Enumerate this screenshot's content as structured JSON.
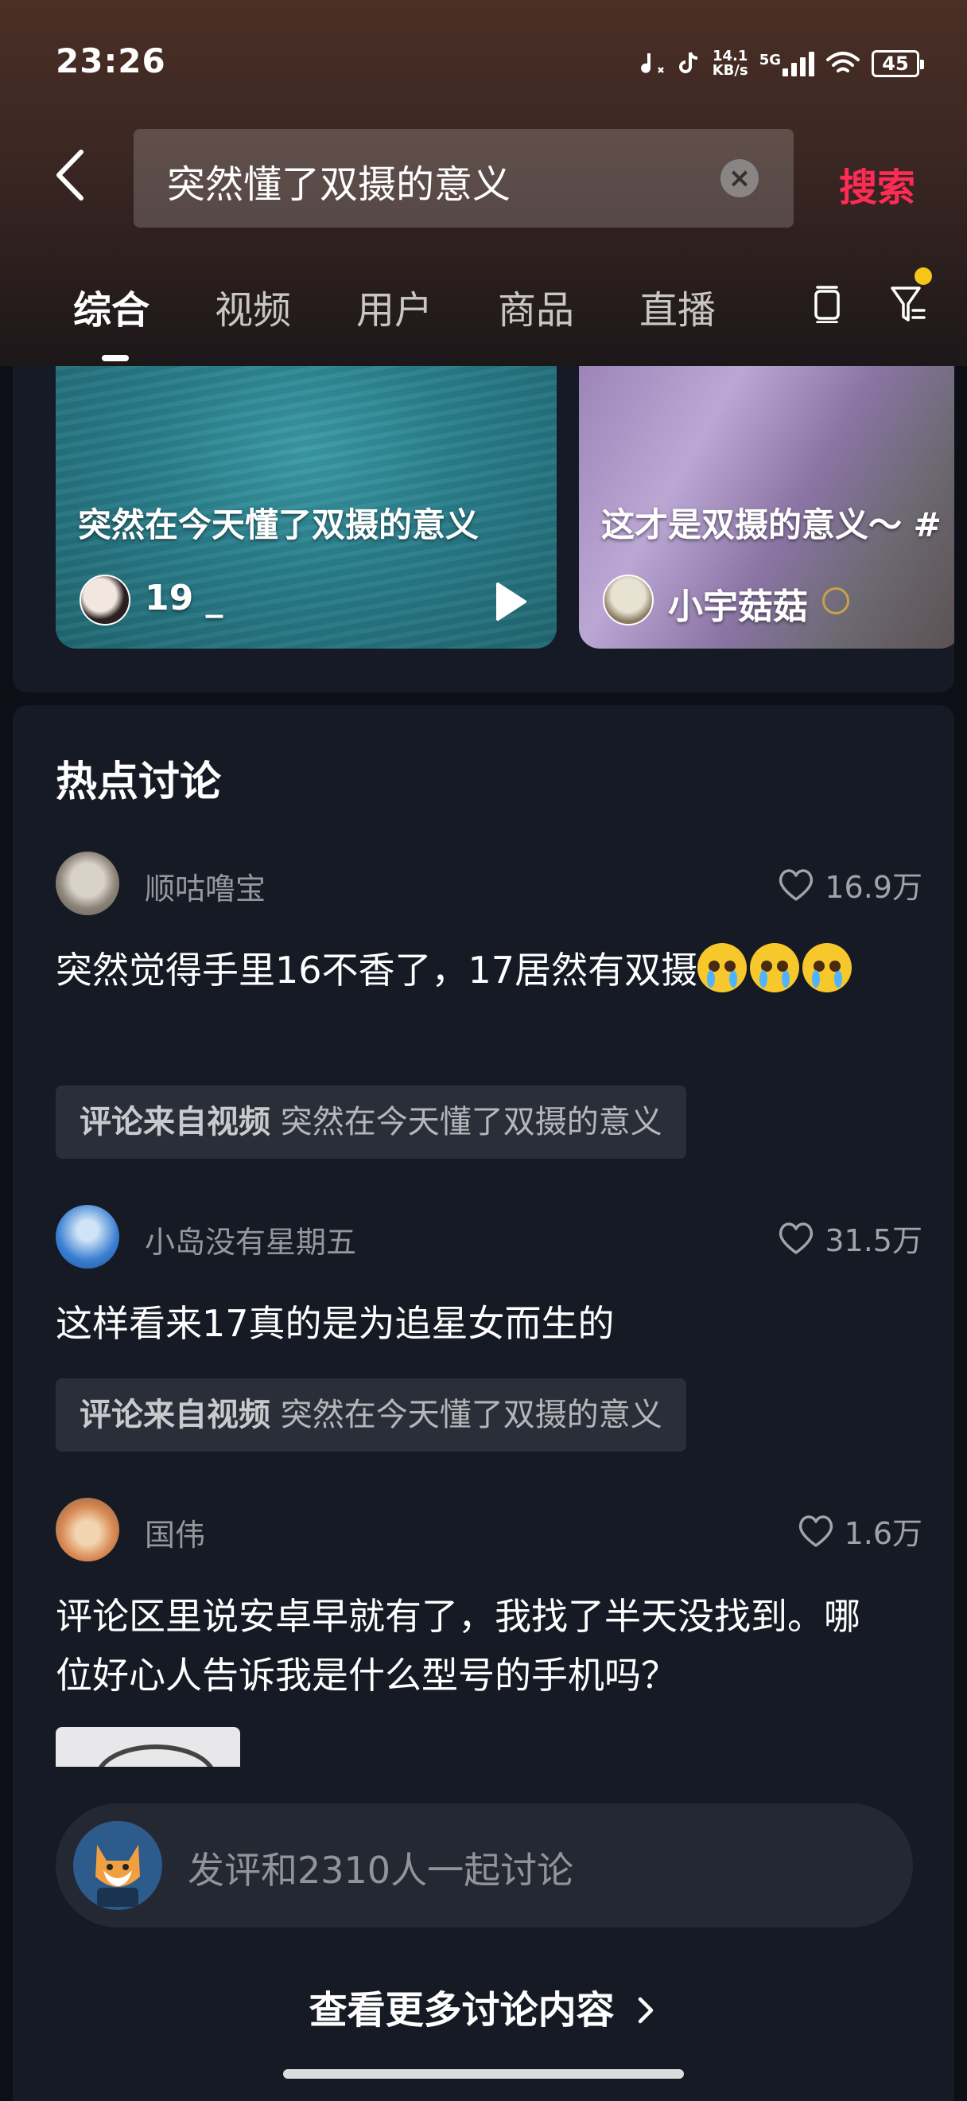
{
  "status_bar": {
    "time": "23:26",
    "net_speed_value": "14.1",
    "net_speed_unit": "KB/s",
    "network": "5G",
    "battery": "45"
  },
  "search": {
    "query": "突然懂了双摄的意义",
    "submit_label": "搜索"
  },
  "tabs": [
    {
      "label": "综合"
    },
    {
      "label": "视频"
    },
    {
      "label": "用户"
    },
    {
      "label": "商品"
    },
    {
      "label": "直播"
    }
  ],
  "video_cards": [
    {
      "title": "突然在今天懂了双摄的意义",
      "author": "19 _"
    },
    {
      "title": "这才是双摄的意义～ #",
      "author": "小宇菇菇"
    }
  ],
  "discussion": {
    "title": "热点讨论",
    "comments": [
      {
        "user": "顺咕噜宝",
        "likes": "16.9万",
        "text": "突然觉得手里16不香了，17居然有双摄",
        "source_prefix": "评论来自视频",
        "source_title": "突然在今天懂了双摄的意义"
      },
      {
        "user": "小岛没有星期五",
        "likes": "31.5万",
        "text": "这样看来17真的是为追星女而生的",
        "source_prefix": "评论来自视频",
        "source_title": "突然在今天懂了双摄的意义"
      },
      {
        "user": "国伟",
        "likes": "1.6万",
        "text": "评论区里说安卓早就有了，我找了半天没找到。哪位好心人告诉我是什么型号的手机吗？"
      }
    ],
    "reply_placeholder": "发评和2310人一起讨论",
    "more_label": "查看更多讨论内容"
  },
  "colors": {
    "accent": "#fe2c55",
    "panel": "#161a24",
    "badge_dot": "#f5c518"
  }
}
